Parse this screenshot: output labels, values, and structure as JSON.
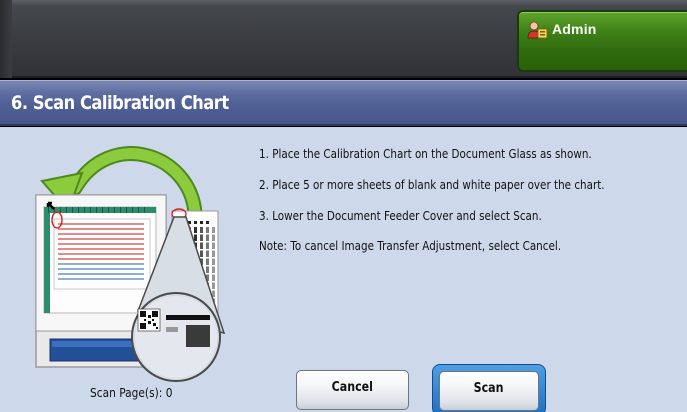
{
  "header": {
    "user_label": "Admin",
    "user_icon": "admin-user-icon"
  },
  "page": {
    "title": "6. Scan Calibration Chart"
  },
  "instructions": [
    "1.  Place the Calibration Chart on the Document Glass as shown.",
    "2.  Place 5 or more sheets of blank and white paper over the chart.",
    "3.  Lower the Document Feeder Cover and select Scan.",
    "Note: To cancel Image Transfer Adjustment, select Cancel."
  ],
  "status": {
    "scan_pages": "Scan Page(s): 0"
  },
  "buttons": {
    "cancel": "Cancel",
    "scan": "Scan"
  },
  "colors": {
    "content_bg": "#cdd9ea",
    "title_bg": "#4f5e93",
    "admin_bg": "#3e7f16",
    "scan_highlight": "#2f82d6",
    "arrow_green": "#7ab82f"
  }
}
